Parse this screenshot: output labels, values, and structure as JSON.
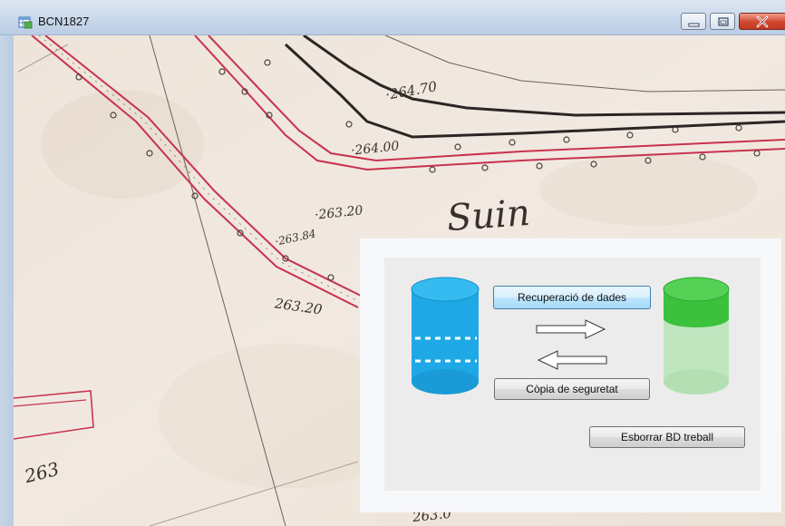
{
  "window": {
    "title": "BCN1827",
    "icon": "app-table-icon",
    "controls": [
      "minimize-icon",
      "maximize-icon",
      "close-icon"
    ]
  },
  "map": {
    "annotations": [
      "·264.70",
      "·264.00",
      "·263.20",
      "·263.84",
      "263.20",
      "Suin",
      "263",
      "263.0"
    ]
  },
  "dialog": {
    "source_db_icon": "database-blue-icon",
    "target_db_icon": "database-green-icon",
    "recover_label": "Recuperació de dades",
    "backup_label": "Còpia de seguretat",
    "erase_label": "Esborrar BD treball",
    "arrow_right_icon": "arrow-right-icon",
    "arrow_left_icon": "arrow-left-icon"
  },
  "colors": {
    "db_blue": "#1ea8e6",
    "db_green": "#3cc13c",
    "db_green_light": "#bfe6bf",
    "map_paper": "#efe6dd",
    "map_red": "#c8324e"
  }
}
